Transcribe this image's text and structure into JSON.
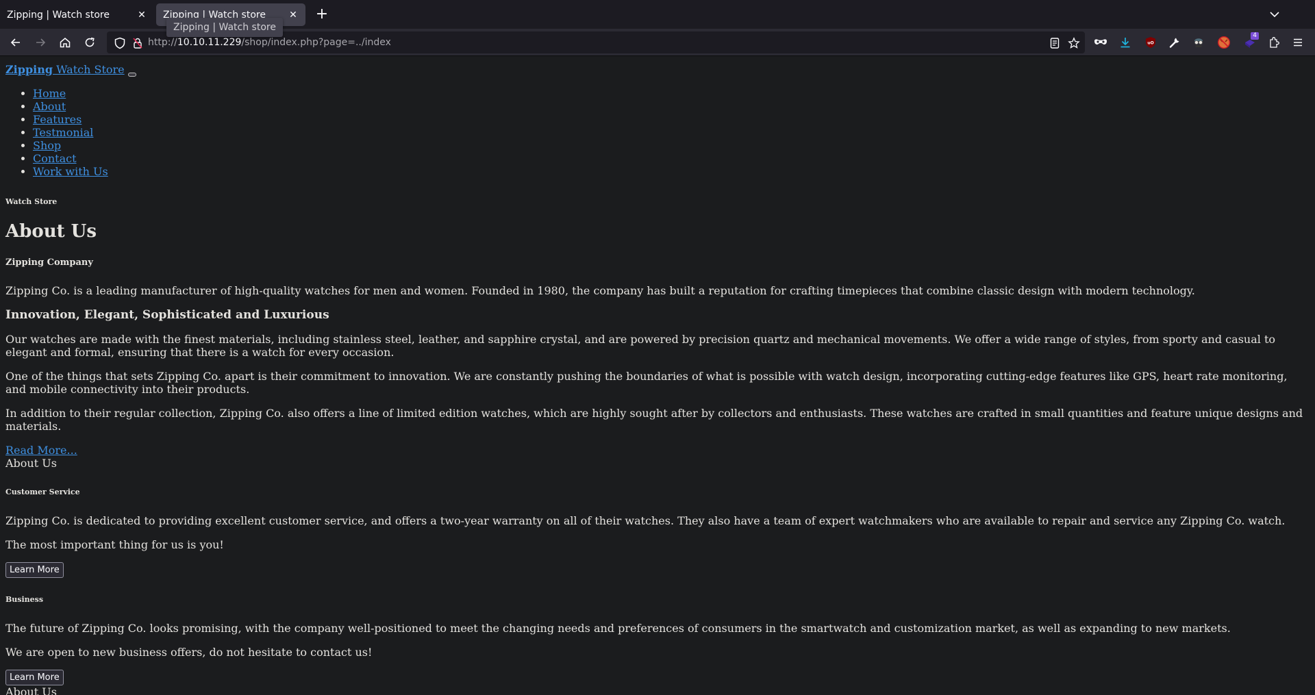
{
  "browser": {
    "tabs": [
      {
        "title": "Zipping | Watch store",
        "active": false
      },
      {
        "title": "Zipping | Watch store",
        "active": true
      }
    ],
    "tooltip": "Zipping | Watch store",
    "new_tab_label": "+",
    "url": {
      "scheme": "http://",
      "host": "10.10.11.229",
      "path": "/shop/index.php?page=../index"
    },
    "extension_badge_count": "4",
    "toolbar_icons": [
      "back-icon",
      "forward-icon",
      "home-icon",
      "reload-icon",
      "shield-icon",
      "insecure-lock-icon",
      "reader-view-icon",
      "bookmark-star-icon",
      "private-mask-icon",
      "download-icon",
      "ublock-icon",
      "wrench-icon",
      "spy-extension-icon",
      "foxyproxy-icon",
      "cube-extension-icon",
      "extensions-puzzle-icon",
      "hamburger-menu-icon"
    ],
    "colors": {
      "tabbar": "#1c1b22",
      "toolbar": "#2b2a33",
      "active_tab": "#42414d",
      "download_accent": "#1fb5e0",
      "ublock_red": "#800000"
    }
  },
  "site": {
    "brand_bold": "Zipping",
    "brand_rest": " Watch Store",
    "nav": [
      "Home",
      "About",
      "Features",
      "Testmonial",
      "Shop",
      "Contact",
      "Work with Us"
    ],
    "link_color": "#3e8fe0",
    "page_bg": "#1b1c1e"
  },
  "about": {
    "eyebrow": "Watch Store",
    "title": "About Us",
    "company_heading": "Zipping Company",
    "intro": "Zipping Co. is a leading manufacturer of high-quality watches for men and women. Founded in 1980, the company has built a reputation for crafting timepieces that combine classic design with modern technology.",
    "subheading": "Innovation, Elegant, Sophisticated and Luxurious",
    "paragraphs": [
      "Our watches are made with the finest materials, including stainless steel, leather, and sapphire crystal, and are powered by precision quartz and mechanical movements. We offer a wide range of styles, from sporty and casual to elegant and formal, ensuring that there is a watch for every occasion.",
      "One of the things that sets Zipping Co. apart is their commitment to innovation. We are constantly pushing the boundaries of what is possible with watch design, incorporating cutting-edge features like GPS, heart rate monitoring, and mobile connectivity into their products.",
      "In addition to their regular collection, Zipping Co. also offers a line of limited edition watches, which are highly sought after by collectors and enthusiasts. These watches are crafted in small quantities and feature unique designs and materials."
    ],
    "read_more": "Read More...",
    "image_alt": "About Us"
  },
  "customer_service": {
    "heading": "Customer Service",
    "paragraphs": [
      "Zipping Co. is dedicated to providing excellent customer service, and offers a two-year warranty on all of their watches. They also have a team of expert watchmakers who are available to repair and service any Zipping Co. watch.",
      "The most important thing for us is you!"
    ],
    "button": "Learn More"
  },
  "business": {
    "heading": "Business",
    "paragraphs": [
      "The future of Zipping Co. looks promising, with the company well-positioned to meet the changing needs and preferences of consumers in the smartwatch and customization market, as well as expanding to new markets.",
      "We are open to new business offers, do not hesitate to contact us!"
    ],
    "button": "Learn More",
    "image_alt": "About Us"
  }
}
